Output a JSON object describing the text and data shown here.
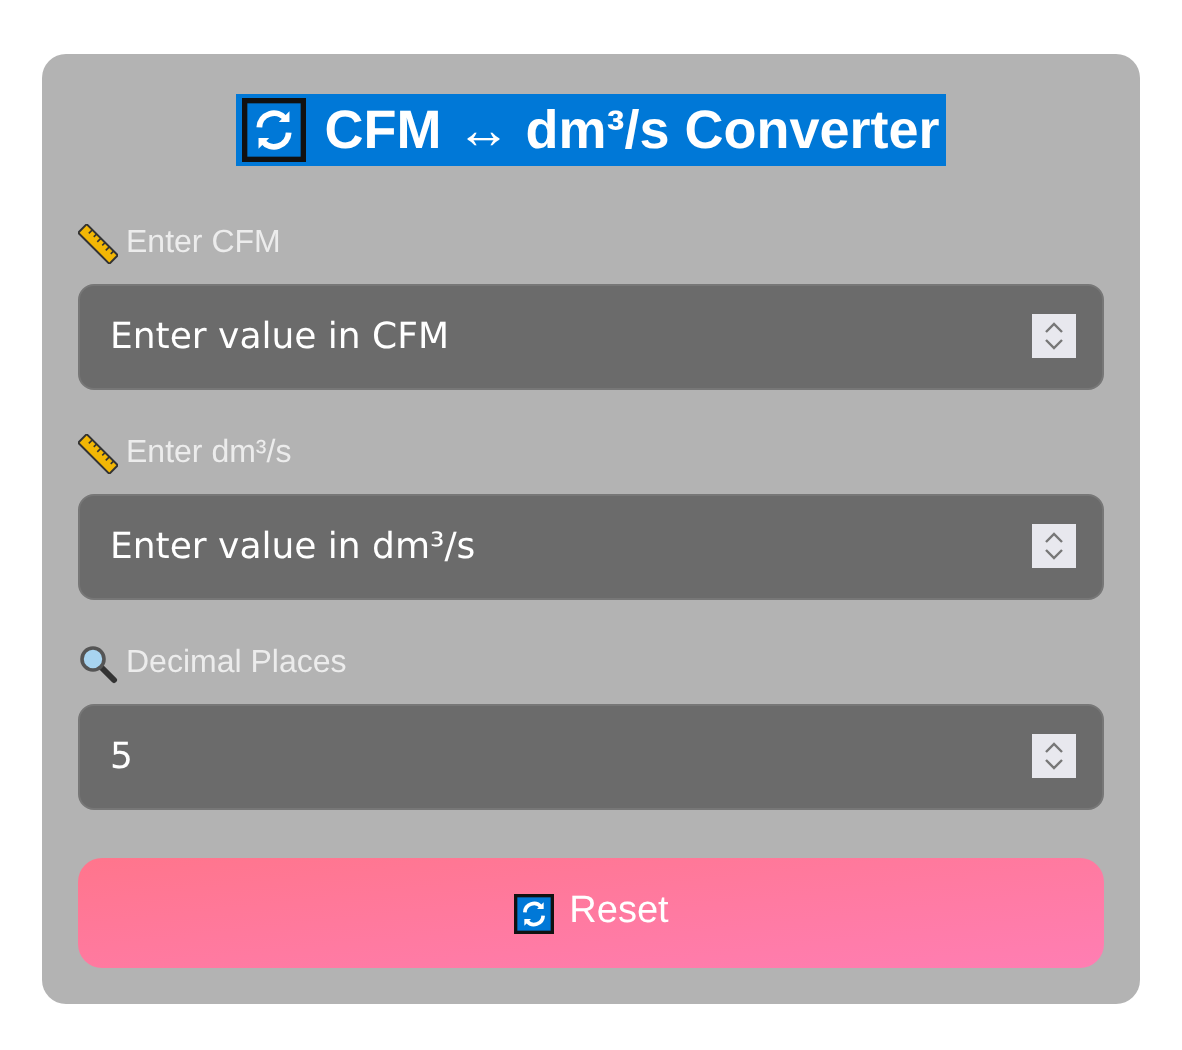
{
  "title": {
    "text": "CFM ↔ dm³/s Converter",
    "highlighted": true
  },
  "fields": [
    {
      "kind": "unit",
      "label": "Enter CFM",
      "placeholder": "Enter value in CFM"
    },
    {
      "kind": "unit",
      "label": "Enter dm³/s",
      "placeholder": "Enter value in dm³/s"
    },
    {
      "kind": "precision",
      "label": "Decimal Places",
      "value": "5"
    }
  ],
  "reset_button": {
    "label": "Reset"
  }
}
